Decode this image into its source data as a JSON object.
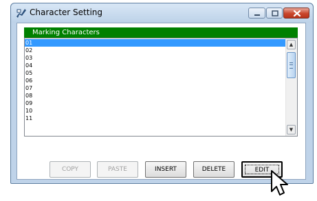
{
  "window": {
    "title": "Character Setting",
    "app_icon": "character-setting-icon",
    "controls": [
      "minimize-icon",
      "maximize-icon",
      "close-icon"
    ]
  },
  "list": {
    "header": "Marking Characters",
    "items": [
      "01",
      "02",
      "03",
      "04",
      "05",
      "06",
      "07",
      "08",
      "09",
      "10",
      "11"
    ],
    "selected_index": 0
  },
  "buttons": {
    "copy": "COPY",
    "paste": "PASTE",
    "insert": "INSERT",
    "delete": "DELETE",
    "edit": "EDIT"
  },
  "colors": {
    "header_bg": "#008000",
    "selection": "#3399ff",
    "close_button": "#c9462c"
  }
}
